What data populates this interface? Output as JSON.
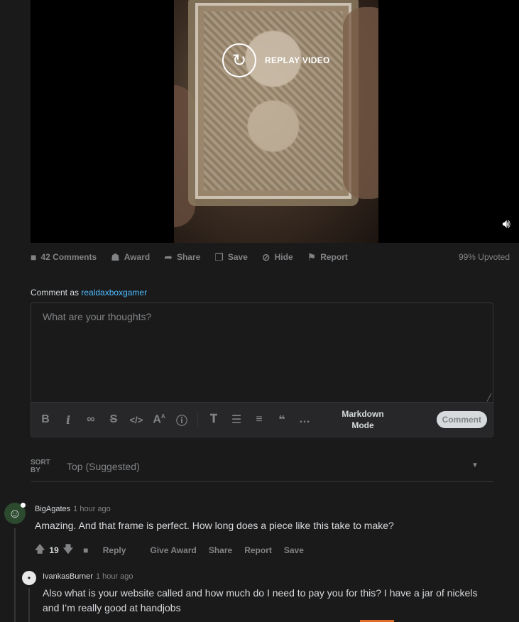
{
  "video": {
    "replay_label": "REPLAY VIDEO",
    "replay_icon": "replay-icon",
    "volume_icon": "volume-icon"
  },
  "post_actions": {
    "comments": "42 Comments",
    "award": "Award",
    "share": "Share",
    "save": "Save",
    "hide": "Hide",
    "report": "Report",
    "upvoted": "99% Upvoted"
  },
  "comment_box": {
    "comment_as_prefix": "Comment as ",
    "username": "realdaxboxgamer",
    "placeholder": "What are your thoughts?",
    "markdown_mode": "Markdown Mode",
    "comment_button": "Comment"
  },
  "sort": {
    "label": "SORT BY",
    "value": "Top (Suggested)"
  },
  "comments": [
    {
      "author": "BigAgates",
      "time": "1 hour ago",
      "body": "Amazing. And that frame is perfect. How long does a piece like this take to make?",
      "score": "19",
      "actions": [
        "Reply",
        "Give Award",
        "Share",
        "Report",
        "Save"
      ]
    },
    {
      "author": "IvankasBurner",
      "time": "1 hour ago",
      "body": "Also what is your website called and how much do I need to pay you for this? I have a jar of nickels and I’m really good at handjobs"
    }
  ],
  "colors": {
    "background": "#1a1a1b",
    "link": "#4fbcff",
    "muted": "#818384",
    "text": "#d7dadc"
  }
}
